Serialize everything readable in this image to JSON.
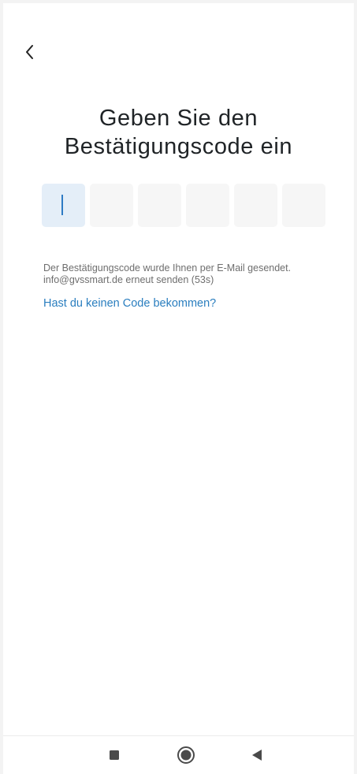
{
  "header": {
    "back_icon": "chevron-left-icon"
  },
  "main": {
    "title": "Geben Sie den\nBestätigungscode ein",
    "code_inputs": [
      {
        "value": "",
        "active": true
      },
      {
        "value": "",
        "active": false
      },
      {
        "value": "",
        "active": false
      },
      {
        "value": "",
        "active": false
      },
      {
        "value": "",
        "active": false
      },
      {
        "value": "",
        "active": false
      }
    ],
    "info_line1": "Der Bestätigungscode wurde Ihnen per E-Mail gesendet.",
    "info_line2": "info@gvssmart.de erneut senden (53s)",
    "no_code_link": "Hast du keinen Code bekommen?"
  },
  "navbar": {
    "items": [
      {
        "icon": "recent-apps-icon"
      },
      {
        "icon": "home-icon"
      },
      {
        "icon": "back-triangle-icon"
      }
    ]
  },
  "colors": {
    "accent": "#2a7ebf",
    "caret": "#2e7bc4",
    "active_box": "#e4eef8",
    "box": "#f6f6f6",
    "title": "#1f2326",
    "info_text": "#6e6e6e"
  }
}
